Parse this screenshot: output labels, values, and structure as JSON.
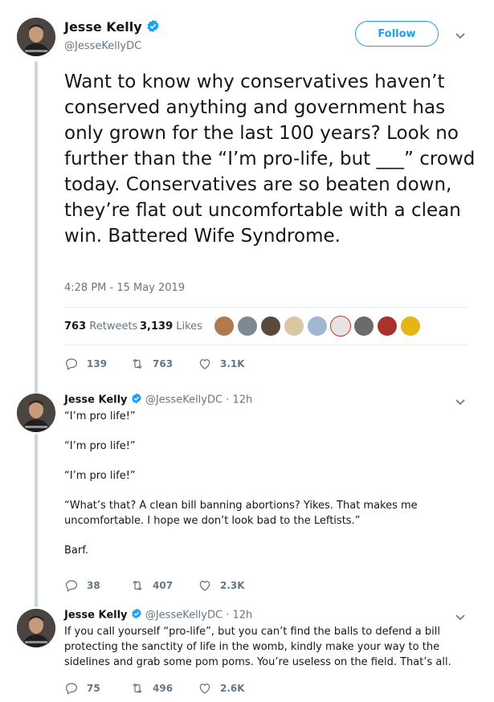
{
  "main_tweet": {
    "name": "Jesse Kelly",
    "handle": "@JesseKellyDC",
    "follow_label": "Follow",
    "text": "Want to know why conservatives haven’t conserved anything and government has only grown for the last 100 years? Look no further than the “I’m pro-life, but ___” crowd today. Conservatives are so beaten down, they’re flat out uncomfortable with a clean win. Battered Wife Syndrome.",
    "timestamp": "4:28 PM - 15 May 2019",
    "retweets_count": "763",
    "retweets_label": "Retweets",
    "likes_count": "3,139",
    "likes_label": "Likes",
    "replies": "139",
    "retweets": "763",
    "likes": "3.1K"
  },
  "replies": [
    {
      "name": "Jesse Kelly",
      "handle": "@JesseKellyDC",
      "time": "· 12h",
      "paragraphs": [
        "“I’m pro life!”",
        "“I’m pro life!”",
        "“I’m pro life!”",
        "“What’s that? A clean bill banning abortions? Yikes. That makes me uncomfortable. I hope we don’t look bad to the Leftists.”",
        "Barf."
      ],
      "replies": "38",
      "retweets": "407",
      "likes": "2.3K"
    },
    {
      "name": "Jesse Kelly",
      "handle": "@JesseKellyDC",
      "time": "· 12h",
      "paragraphs": [
        "If you call yourself “pro-life”, but you can’t find the balls to defend a bill protecting the sanctity of life in the womb, kindly make your way to the sidelines and grab some pom poms. You’re useless on the field. That’s all."
      ],
      "replies": "75",
      "retweets": "496",
      "likes": "2.6K"
    }
  ],
  "colors": {
    "accent": "#1da1f2",
    "muted": "#657786",
    "text": "#14171a",
    "divider": "#e6ecf0"
  }
}
